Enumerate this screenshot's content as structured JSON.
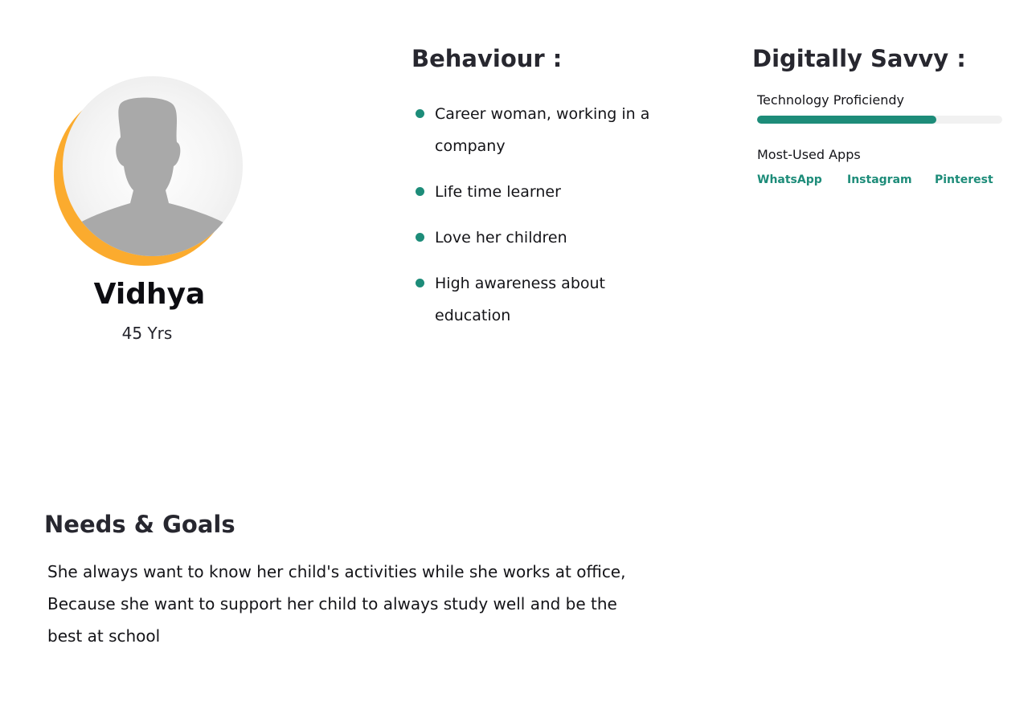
{
  "persona": {
    "name": "Vidhya",
    "age": "45 Yrs"
  },
  "behaviour": {
    "title": "Behaviour :",
    "items": [
      "Career woman, working in a company",
      "Life time learner",
      "Love her children",
      "High awareness about education"
    ]
  },
  "digital_savvy": {
    "title": "Digitally Savvy :",
    "tech_label": "Technology Proficiendy",
    "tech_level_percent": 73,
    "apps_label": "Most-Used Apps",
    "apps": [
      "WhatsApp",
      "Instagram",
      "Pinterest"
    ]
  },
  "needs_goals": {
    "title": "Needs & Goals",
    "text": "She always want to know her child's activities while she works at office, Because she want to support her child to always study well and be the best at school"
  },
  "colors": {
    "accent": "#1d8c79",
    "ring": "#fbab2e",
    "silhouette": "#a9a9a9"
  },
  "icons": {
    "avatar": "user-silhouette-icon",
    "bullet": "dot-icon"
  }
}
